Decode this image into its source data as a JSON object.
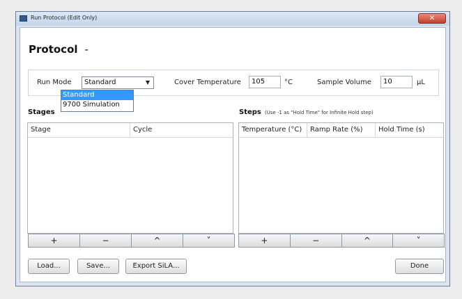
{
  "window": {
    "title": "Run Protocol (Edit Only)",
    "close_glyph": "✕"
  },
  "protocol": {
    "title": "Protocol",
    "name": "-"
  },
  "settings": {
    "run_mode_label": "Run Mode",
    "run_mode_value": "Standard",
    "run_mode_options": [
      "Standard",
      "9700 Simulation"
    ],
    "cover_temp_label": "Cover Temperature",
    "cover_temp_value": "105",
    "cover_temp_unit": "°C",
    "sample_volume_label": "Sample Volume",
    "sample_volume_value": "10",
    "sample_volume_unit": "μL"
  },
  "stages": {
    "label": "Stages",
    "columns": [
      "Stage",
      "Cycle"
    ],
    "buttons": [
      "+",
      "−",
      "^",
      "˅"
    ]
  },
  "steps": {
    "label": "Steps",
    "note": "(Use -1 as \"Hold Time\" for Infinite Hold step)",
    "columns": [
      "Temperature (°C)",
      "Ramp Rate (%)",
      "Hold Time (s)"
    ],
    "buttons": [
      "+",
      "−",
      "^",
      "˅"
    ]
  },
  "footer": {
    "load": "Load...",
    "save": "Save...",
    "export": "Export SiLA...",
    "done": "Done"
  },
  "icons": {
    "app": "app-window-icon",
    "close": "close-icon",
    "dropdown": "chevron-down-icon"
  }
}
